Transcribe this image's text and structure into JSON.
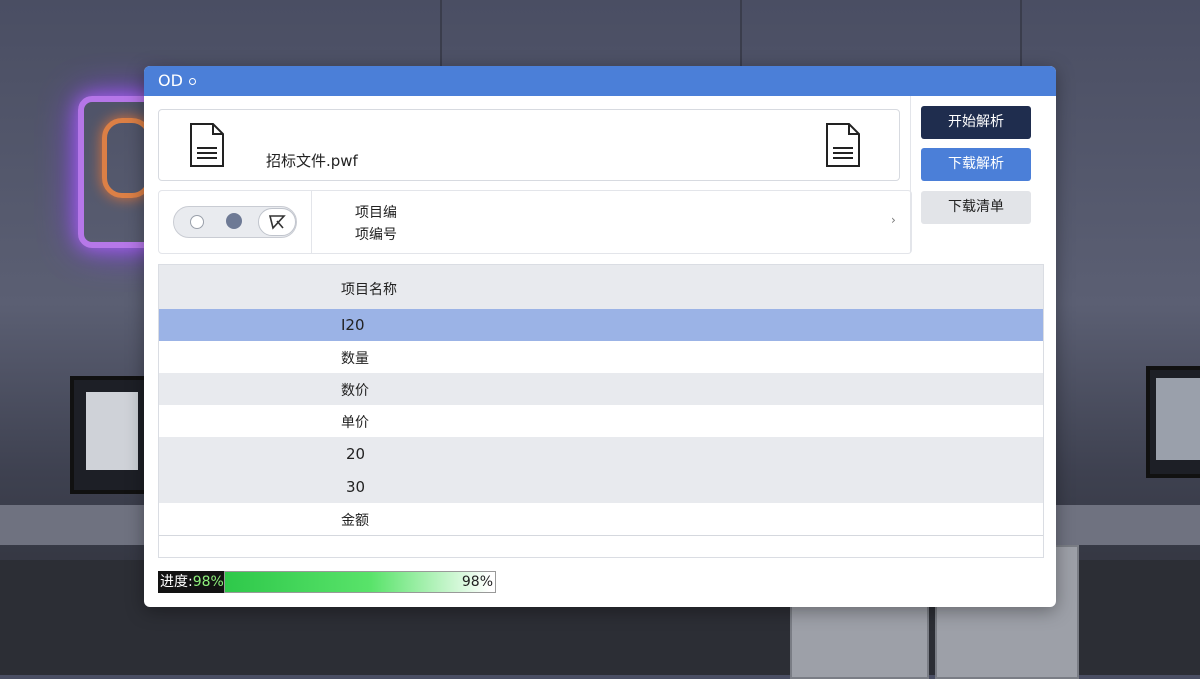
{
  "window": {
    "title": "OD"
  },
  "file": {
    "name": "招标文件.pwf"
  },
  "options": {
    "line1": "项目编",
    "line2": "项编号",
    "chevron": "›"
  },
  "buttons": {
    "start": "开始解析",
    "download_parse": "下载解析",
    "download_list": "下载清单"
  },
  "table": {
    "header": "项目名称",
    "rows": [
      "I20",
      "数量",
      "数价",
      "单价",
      "20",
      "30",
      "金额"
    ]
  },
  "progress": {
    "label": "进度:",
    "label_value": "98%",
    "value_text": "98%",
    "fraction": 0.98
  },
  "colors": {
    "titlebar": "#4b7fd8",
    "start_button": "#1f2d4e",
    "download_button": "#4b7fd8",
    "selected_row": "#9bb3e6",
    "progress_fill": "#2ec84a"
  },
  "icons": [
    "document-icon",
    "radio-icon",
    "dot-icon",
    "cursor-icon",
    "chevron-right-icon"
  ]
}
